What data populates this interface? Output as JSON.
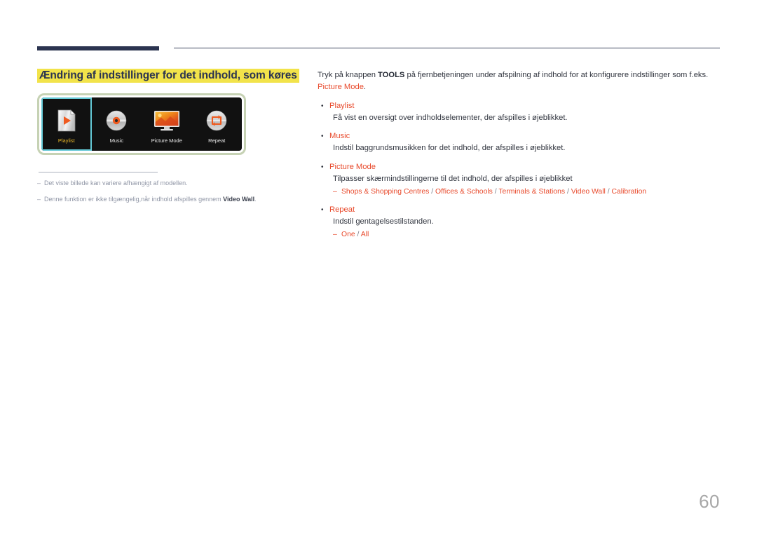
{
  "header": {
    "rule_color": "#2b3450"
  },
  "section": {
    "title": "Ændring af indstillinger for det indhold, som køres",
    "highlight_color": "#f2e34a",
    "title_color": "#2b3450"
  },
  "figure": {
    "frame_color": "#c6d2b4",
    "screen_color": "#111111",
    "selection_color": "#63c9d6",
    "tiles": [
      {
        "label": "Playlist",
        "icon": "playlist-document-play-icon",
        "selected": true
      },
      {
        "label": "Music",
        "icon": "music-disc-icon",
        "selected": false
      },
      {
        "label": "Picture Mode",
        "icon": "picture-mode-monitor-icon",
        "selected": false
      },
      {
        "label": "Repeat",
        "icon": "repeat-loop-icon",
        "selected": false
      }
    ]
  },
  "footnotes": [
    {
      "dash": "–",
      "text": "Det viste billede kan variere afhængigt af modellen.",
      "bold_tail": ""
    },
    {
      "dash": "–",
      "text": "Denne funktion er ikke tilgængelig,når indhold afspilles gennem ",
      "bold_tail": "Video Wall",
      "tail": "."
    }
  ],
  "content": {
    "intro_part1": "Tryk på knappen ",
    "intro_bold": "TOOLS",
    "intro_part2": " på fjernbetjeningen under afspilning af indhold for at konfigurere indstillinger som f.eks. ",
    "intro_accent": "Picture Mode",
    "intro_part3": ".",
    "accent_color": "#e8492b",
    "bullet_glyph": "•",
    "sub_dash": "–",
    "items": [
      {
        "title": "Playlist",
        "desc": "Få vist en oversigt over indholdselementer, der afspilles i øjeblikket.",
        "options": []
      },
      {
        "title": "Music",
        "desc": "Indstil baggrundsmusikken for det indhold, der afspilles i øjeblikket.",
        "options": []
      },
      {
        "title": "Picture Mode",
        "desc": "Tilpasser skærmindstillingerne til det indhold, der afspilles i øjeblikket",
        "options": [
          "Shops & Shopping Centres",
          "Offices & Schools",
          "Terminals & Stations",
          "Video Wall",
          "Calibration"
        ]
      },
      {
        "title": "Repeat",
        "desc": "Indstil gentagelsestilstanden.",
        "options": [
          "One",
          "All"
        ]
      }
    ]
  },
  "footer": {
    "page_number": "60"
  }
}
